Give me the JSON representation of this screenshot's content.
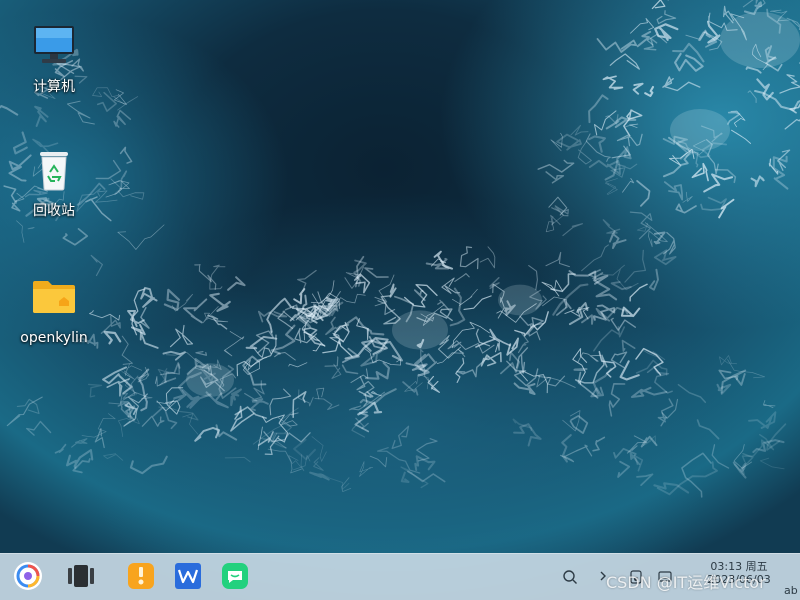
{
  "desktop": {
    "icons": [
      {
        "label": "计算机",
        "icon": "computer-icon"
      },
      {
        "label": "回收站",
        "icon": "trash-icon"
      },
      {
        "label": "openkylin",
        "icon": "home-folder-icon"
      }
    ]
  },
  "taskbar": {
    "apps": [
      {
        "name": "start-menu",
        "icon": "openkylin-logo-icon"
      },
      {
        "name": "multitasking-view",
        "icon": "multitask-icon"
      },
      {
        "name": "file-manager",
        "icon": "file-manager-icon"
      },
      {
        "name": "wps-office",
        "icon": "wps-icon"
      },
      {
        "name": "chat-app",
        "icon": "chat-icon"
      }
    ],
    "tray": {
      "time": "03:13",
      "weekday": "周五",
      "date": "2023/06/03",
      "ime": "ab"
    }
  },
  "watermark": "CSDN @IT运维Victor",
  "colors": {
    "taskbar": "#c4d6e2",
    "wallpaper_deep": "#0b2233",
    "wallpaper_mid": "#15506c",
    "foam": "#e6f3fb",
    "folder": "#f7c23a"
  }
}
